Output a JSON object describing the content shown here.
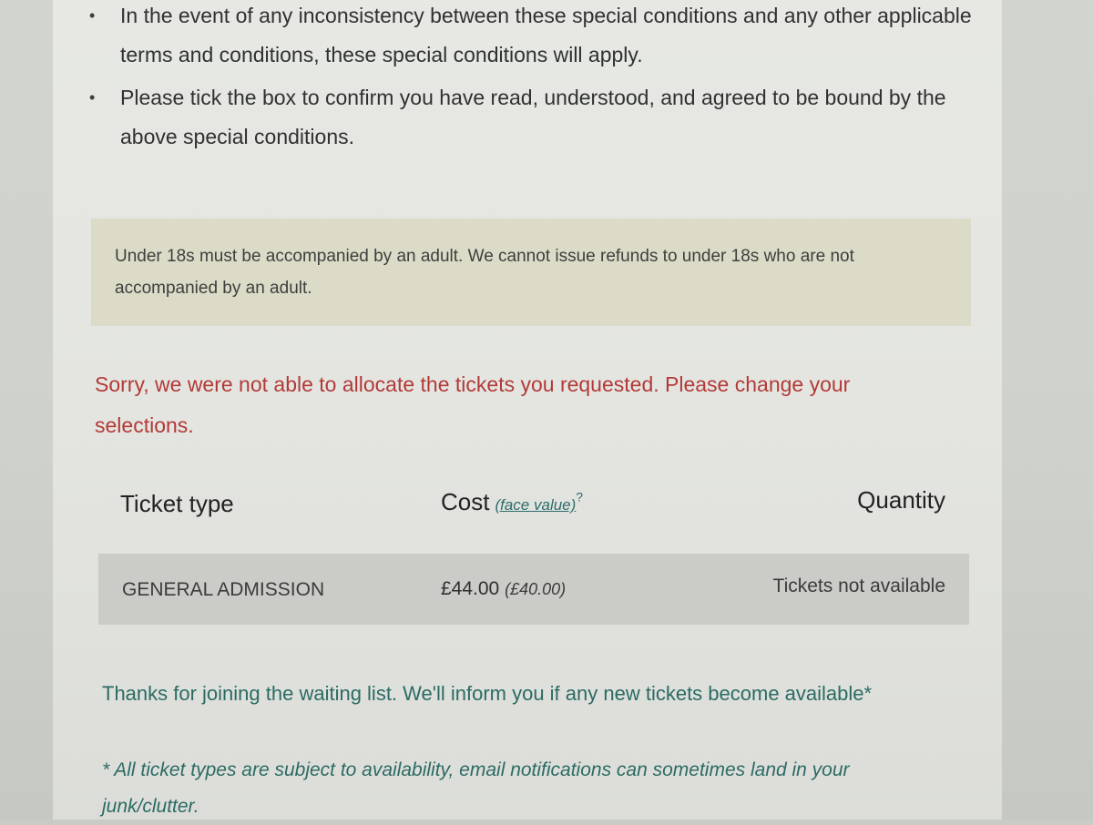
{
  "conditions": {
    "items": [
      {
        "text": "In the event of any inconsistency between these special conditions and any other applicable terms and conditions, these special conditions will apply."
      },
      {
        "text": "Please tick the box to confirm you have read, understood, and agreed to be bound by the above special conditions."
      }
    ]
  },
  "notice": {
    "text": "Under 18s must be accompanied by an adult. We cannot issue refunds to under 18s who are not accompanied by an adult."
  },
  "error": {
    "text": "Sorry, we were not able to allocate the tickets you requested. Please change your selections."
  },
  "table": {
    "headers": {
      "ticket_type": "Ticket type",
      "cost": "Cost",
      "face_value_link": "(face value)",
      "help": "?",
      "quantity": "Quantity"
    },
    "rows": [
      {
        "ticket_type": "GENERAL ADMISSION",
        "price": "£44.00",
        "face_value": "(£40.00)",
        "quantity": "Tickets not available"
      }
    ]
  },
  "waiting_list": {
    "message": "Thanks for joining the waiting list. We'll inform you if any new tickets become available*",
    "footnote": "* All ticket types are subject to availability, email notifications can sometimes land in your junk/clutter."
  },
  "colors": {
    "error": "#b23a37",
    "link": "#2c6c6b",
    "notice_bg": "#dcdbc8",
    "row_bg": "#cbccc8"
  }
}
